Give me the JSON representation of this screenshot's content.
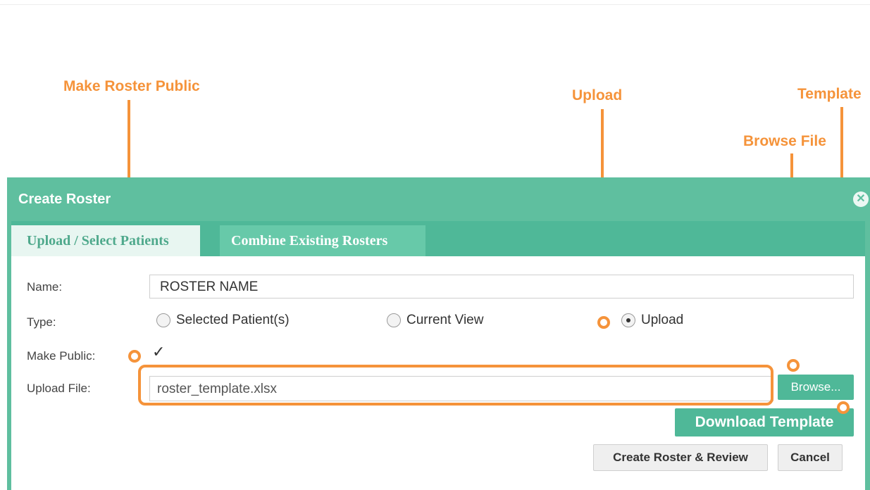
{
  "annotations": {
    "make_public": "Make Roster Public",
    "upload": "Upload",
    "template": "Template",
    "browse_file": "Browse File",
    "color": "#f5933a"
  },
  "dialog": {
    "title": "Create Roster",
    "close_icon": "close-icon",
    "accent_color": "#5fbf9f",
    "tabs": [
      {
        "label": "Upload / Select Patients",
        "active": true
      },
      {
        "label": "Combine Existing Rosters",
        "active": false
      }
    ],
    "form": {
      "name_label": "Name:",
      "name_value": "ROSTER NAME",
      "type_label": "Type:",
      "type_options": [
        {
          "label": "Selected Patient(s)",
          "checked": false
        },
        {
          "label": "Current View",
          "checked": false
        },
        {
          "label": "Upload",
          "checked": true
        }
      ],
      "public_label": "Make Public:",
      "public_checked": true,
      "file_label": "Upload File:",
      "file_value": "roster_template.xlsx"
    },
    "buttons": {
      "browse": "Browse...",
      "download_template": "Download Template",
      "create_review": "Create Roster & Review",
      "cancel": "Cancel"
    }
  }
}
